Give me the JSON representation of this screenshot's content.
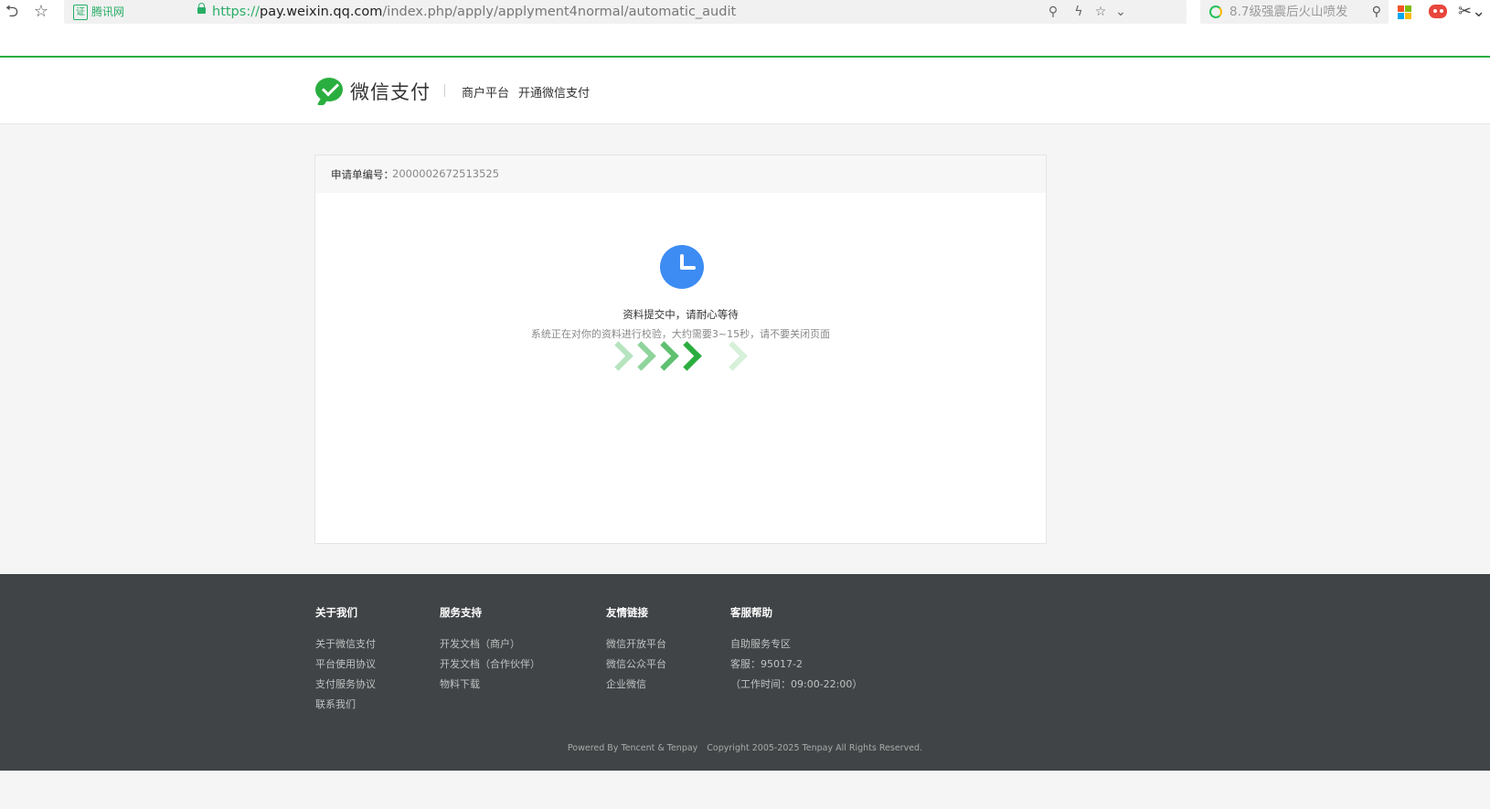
{
  "browser": {
    "cert_label": "腾讯网",
    "url_scheme": "https://",
    "url_host": "pay.weixin.qq.com",
    "url_path": "/index.php/apply/applyment4normal/automatic_audit",
    "search_text": "8.7级强震后火山喷发"
  },
  "header": {
    "logo_text": "微信支付",
    "nav": [
      "商户平台",
      "开通微信支付"
    ]
  },
  "application": {
    "number_label": "申请单编号：",
    "number_value": "2000002672513525"
  },
  "status": {
    "title": "资料提交中，请耐心等待",
    "description": "系统正在对你的资料进行校验，大约需要3~15秒，请不要关闭页面"
  },
  "footer": {
    "columns": [
      {
        "title": "关于我们",
        "links": [
          "关于微信支付",
          "平台使用协议",
          "支付服务协议",
          "联系我们"
        ]
      },
      {
        "title": "服务支持",
        "links": [
          "开发文档（商户）",
          "开发文档（合作伙伴）",
          "物料下载"
        ]
      },
      {
        "title": "友情链接",
        "links": [
          "微信开放平台",
          "微信公众平台",
          "企业微信"
        ]
      },
      {
        "title": "客服帮助",
        "links": [
          "自助服务专区",
          "客服：95017-2",
          "（工作时间：09:00-22:00）"
        ]
      }
    ],
    "powered_by": "Powered By Tencent & Tenpay",
    "copyright": "Copyright 2005-2025 Tenpay All Rights Reserved."
  },
  "colors": {
    "brand_green": "#2aae3f",
    "clock_blue": "#3d8cf4",
    "footer_bg": "#404446"
  }
}
